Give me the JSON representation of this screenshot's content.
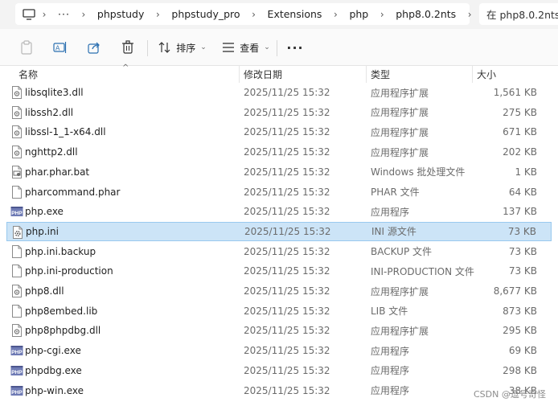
{
  "address_bar": {
    "crumbs": [
      "phpstudy",
      "phpstudy_pro",
      "Extensions",
      "php",
      "php8.0.2nts"
    ]
  },
  "search": {
    "placeholder": "在 php8.0.2nts"
  },
  "toolbar": {
    "sort_label": "排序",
    "view_label": "查看"
  },
  "columns": {
    "name": "名称",
    "date": "修改日期",
    "type": "类型",
    "size": "大小"
  },
  "files": [
    {
      "name": "libsqlite3.dll",
      "date": "2025/11/25 15:32",
      "type": "应用程序扩展",
      "size": "1,561 KB",
      "icon": "dll-file-icon"
    },
    {
      "name": "libssh2.dll",
      "date": "2025/11/25 15:32",
      "type": "应用程序扩展",
      "size": "275 KB",
      "icon": "dll-file-icon"
    },
    {
      "name": "libssl-1_1-x64.dll",
      "date": "2025/11/25 15:32",
      "type": "应用程序扩展",
      "size": "671 KB",
      "icon": "dll-file-icon"
    },
    {
      "name": "nghttp2.dll",
      "date": "2025/11/25 15:32",
      "type": "应用程序扩展",
      "size": "202 KB",
      "icon": "dll-file-icon"
    },
    {
      "name": "phar.phar.bat",
      "date": "2025/11/25 15:32",
      "type": "Windows 批处理文件",
      "size": "1 KB",
      "icon": "bat-file-icon"
    },
    {
      "name": "pharcommand.phar",
      "date": "2025/11/25 15:32",
      "type": "PHAR 文件",
      "size": "64 KB",
      "icon": "blank-file-icon"
    },
    {
      "name": "php.exe",
      "date": "2025/11/25 15:32",
      "type": "应用程序",
      "size": "137 KB",
      "icon": "php-exe-icon"
    },
    {
      "name": "php.ini",
      "date": "2025/11/25 15:32",
      "type": "INI 源文件",
      "size": "73 KB",
      "icon": "ini-file-icon",
      "selected": true
    },
    {
      "name": "php.ini.backup",
      "date": "2025/11/25 15:32",
      "type": "BACKUP 文件",
      "size": "73 KB",
      "icon": "blank-file-icon"
    },
    {
      "name": "php.ini-production",
      "date": "2025/11/25 15:32",
      "type": "INI-PRODUCTION 文件",
      "size": "73 KB",
      "icon": "blank-file-icon"
    },
    {
      "name": "php8.dll",
      "date": "2025/11/25 15:32",
      "type": "应用程序扩展",
      "size": "8,677 KB",
      "icon": "dll-file-icon"
    },
    {
      "name": "php8embed.lib",
      "date": "2025/11/25 15:32",
      "type": "LIB 文件",
      "size": "873 KB",
      "icon": "blank-file-icon"
    },
    {
      "name": "php8phpdbg.dll",
      "date": "2025/11/25 15:32",
      "type": "应用程序扩展",
      "size": "295 KB",
      "icon": "dll-file-icon"
    },
    {
      "name": "php-cgi.exe",
      "date": "2025/11/25 15:32",
      "type": "应用程序",
      "size": "69 KB",
      "icon": "php-exe-icon"
    },
    {
      "name": "phpdbg.exe",
      "date": "2025/11/25 15:32",
      "type": "应用程序",
      "size": "298 KB",
      "icon": "php-exe-icon"
    },
    {
      "name": "php-win.exe",
      "date": "2025/11/25 15:32",
      "type": "应用程序",
      "size": "38 KB",
      "icon": "php-exe-icon"
    }
  ],
  "watermark": "CSDN @逗号奇怪",
  "colors": {
    "selection_bg": "#cce4f7",
    "selection_border": "#99c9ef",
    "php_icon": "#6f7bb5"
  }
}
